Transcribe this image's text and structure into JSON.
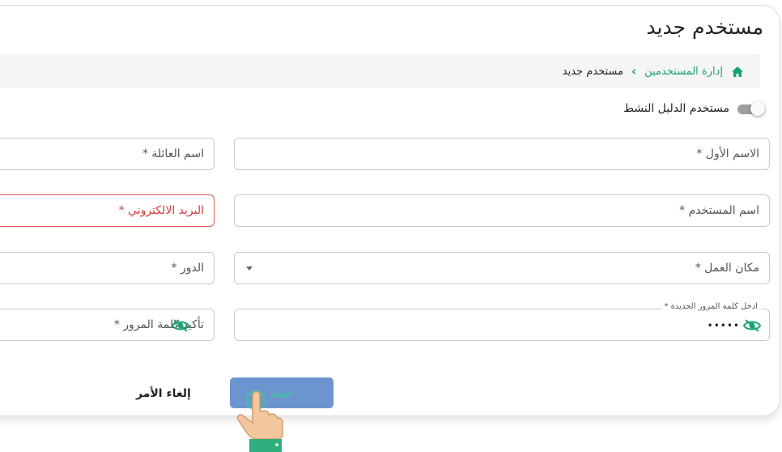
{
  "page": {
    "title": "مستخدم جديد"
  },
  "breadcrumb": {
    "home_icon": "home-icon",
    "link": "إدارة المستخدمين",
    "separator": "›",
    "current": "مستخدم جديد"
  },
  "toggle": {
    "label": "مستخدم الدليل النشط",
    "checked": false
  },
  "form": {
    "first_name": "الاسم الأول *",
    "last_name": "اسم العائلة *",
    "username": "اسم المستخدم *",
    "email": "البريد الالكتروني *",
    "workplace": "مكان العمل *",
    "role": "الدور *",
    "new_password": {
      "label": "ادخل كلمة المرور الجديدة *",
      "value": "•••••"
    },
    "confirm_password": "تأكيد كلمة المرور *"
  },
  "actions": {
    "cancel": "إلغاء الأمر",
    "save": "حفظ"
  },
  "colors": {
    "accent": "#1aa36f",
    "save_button": "#6c95cf",
    "error": "#e05555"
  }
}
